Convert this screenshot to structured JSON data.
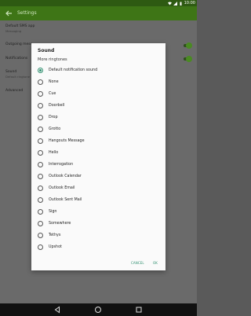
{
  "status_bar": {
    "time": "10:00",
    "icons": [
      "wifi-icon",
      "signal-icon",
      "battery-icon"
    ]
  },
  "app_bar": {
    "title": "Settings"
  },
  "settings": [
    {
      "title": "Default SMS app",
      "subtitle": "Messaging"
    },
    {
      "title": "Outgoing mess",
      "subtitle": ""
    },
    {
      "title": "Notifications",
      "subtitle": ""
    },
    {
      "title": "Sound",
      "subtitle": "Default ringtone"
    },
    {
      "title": "Advanced",
      "subtitle": ""
    }
  ],
  "dialog": {
    "title": "Sound",
    "section": "More ringtones",
    "selected": "Default notification sound",
    "options": [
      "Default notification sound",
      "None",
      "Cue",
      "Doorbell",
      "Drop",
      "Grotto",
      "Hangouts Message",
      "Hello",
      "Interrogation",
      "Outlook Calendar",
      "Outlook Email",
      "Outlook Sent Mail",
      "Sign",
      "Somewhere",
      "Tethys",
      "Upshot"
    ],
    "cancel_label": "CANCEL",
    "ok_label": "OK"
  },
  "colors": {
    "app_bar": "#3e7516",
    "status_bar": "#2e5a12",
    "accent": "#2f8f6f"
  },
  "nav_bar": {
    "icons": [
      "back-icon",
      "home-icon",
      "recents-icon"
    ]
  }
}
